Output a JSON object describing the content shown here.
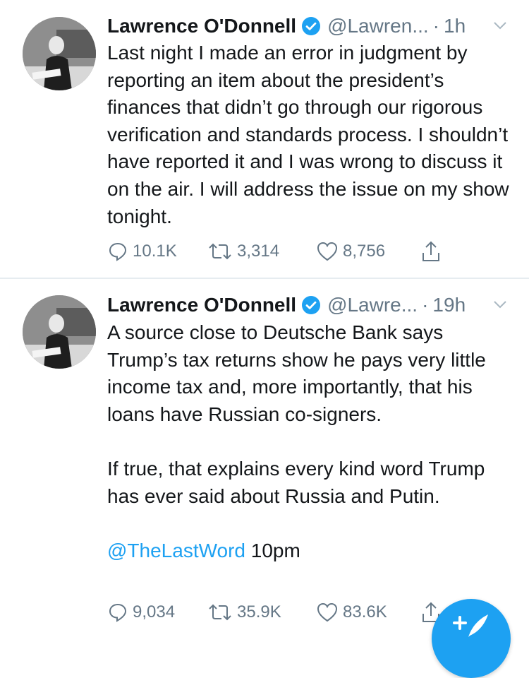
{
  "tweets": [
    {
      "name": "Lawrence O'Donnell",
      "handle": "@Lawren...",
      "dot": "·",
      "time": "1h",
      "text": "Last night I made an error in judgment by reporting an item about the president’s finances that didn’t go through our rigorous verification and standards process. I shouldn’t have reported it and I was wrong to discuss it on the air. I will address the issue on my show tonight.",
      "replies": "10.1K",
      "retweets": "3,314",
      "likes": "8,756"
    },
    {
      "name": "Lawrence O'Donnell",
      "handle": "@Lawre...",
      "dot": "·",
      "time": "19h",
      "text": "A source close to Deutsche Bank says Trump’s tax returns show he pays very little income tax and, more importantly, that his loans have Russian co-signers.\n\nIf true, that explains every kind word Trump has ever said about Russia and Putin.\n\n",
      "mention": "@TheLastWord",
      "text_suffix": " 10pm",
      "replies": "9,034",
      "retweets": "35.9K",
      "likes": "83.6K"
    }
  ],
  "colors": {
    "accent": "#1da1f2",
    "secondary_text": "#657786",
    "primary_text": "#14171a",
    "divider": "#e6ecf0"
  },
  "icons": [
    "verified-badge-icon",
    "chevron-down-icon",
    "reply-icon",
    "retweet-icon",
    "like-icon",
    "share-icon",
    "compose-tweet-icon"
  ]
}
